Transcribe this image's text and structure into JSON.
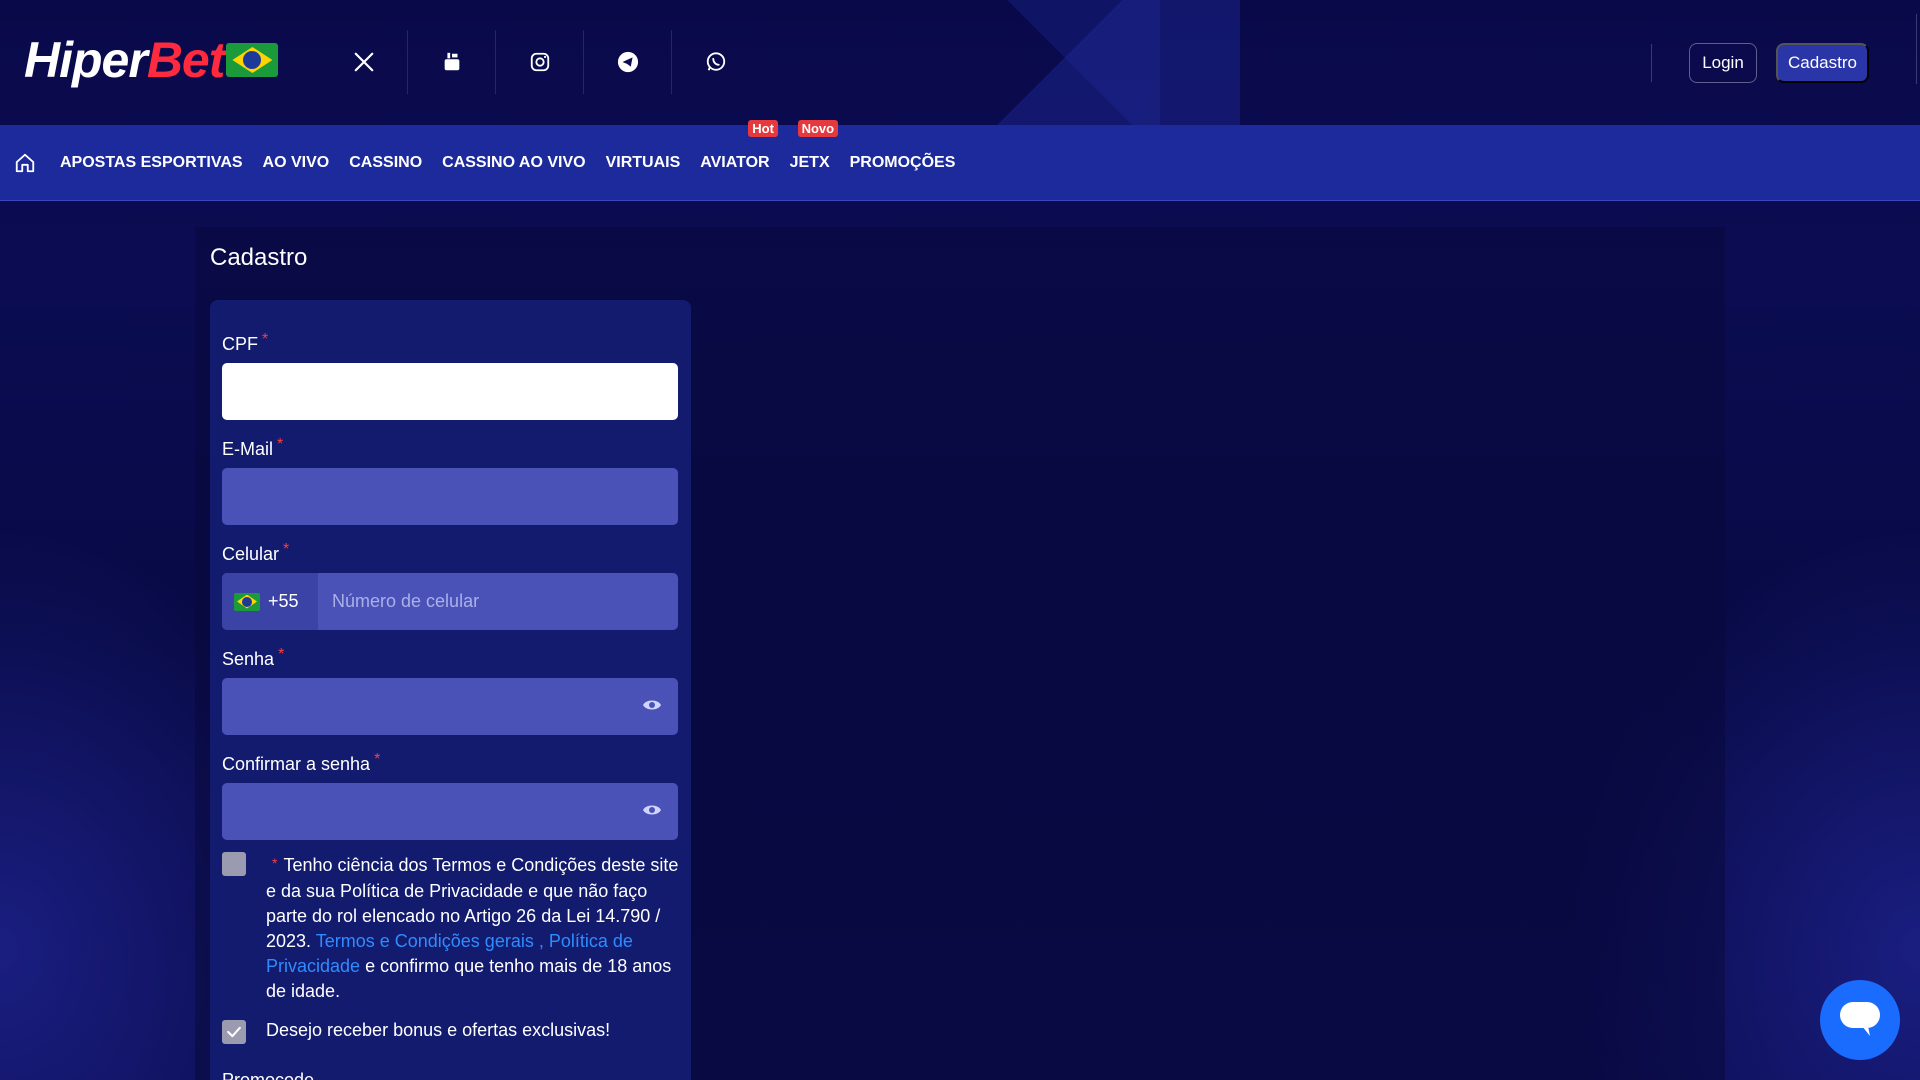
{
  "header": {
    "logo_part1": "Hiper",
    "logo_part2": "Bet",
    "socials": [
      "x-icon",
      "youtube-icon",
      "instagram-icon",
      "telegram-icon",
      "whatsapp-icon"
    ],
    "login_label": "Login",
    "signup_label": "Cadastro"
  },
  "nav": {
    "items": [
      {
        "label": "APOSTAS ESPORTIVAS",
        "badge": ""
      },
      {
        "label": "AO VIVO",
        "badge": ""
      },
      {
        "label": "CASSINO",
        "badge": ""
      },
      {
        "label": "CASSINO AO VIVO",
        "badge": ""
      },
      {
        "label": "VIRTUAIS",
        "badge": ""
      },
      {
        "label": "AVIATOR",
        "badge": "Hot"
      },
      {
        "label": "JETX",
        "badge": "Novo"
      },
      {
        "label": "PROMOÇÕES",
        "badge": ""
      }
    ]
  },
  "page": {
    "title": "Cadastro"
  },
  "form": {
    "required_mark": "*",
    "cpf_label": "CPF",
    "cpf_value": "",
    "email_label": "E-Mail",
    "email_value": "",
    "phone_label": "Celular",
    "phone_code": "+55",
    "phone_placeholder": "Número de celular",
    "password_label": "Senha",
    "confirm_label": "Confirmar a senha",
    "terms_text_1": "Tenho ciência dos Termos e Condições deste site e da sua Política de Privacidade e que não faço parte do rol elencado no Artigo 26 da Lei 14.790 / 2023. ",
    "terms_link": "Termos e Condições gerais , Política de Privacidade",
    "terms_text_2": " e confirmo que tenho mais de 18 anos de idade.",
    "terms_checked": false,
    "bonus_text": "Desejo receber bonus e ofertas exclusivas!",
    "bonus_checked": true,
    "promo_label": "Promocode"
  },
  "colors": {
    "background": "#07083f",
    "nav": "#1d2a9c",
    "card": "#131b6e",
    "input": "#4a52b8",
    "accent_red": "#ff2a3d",
    "link": "#2f8cff",
    "chat": "#1a6cff"
  }
}
